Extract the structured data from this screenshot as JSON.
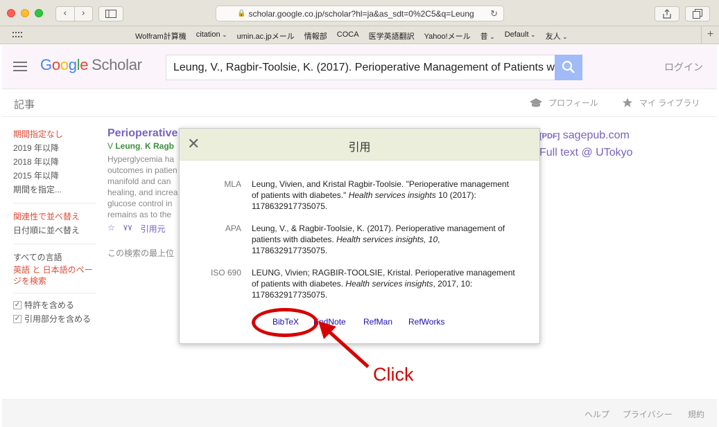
{
  "browser": {
    "url": "scholar.google.co.jp/scholar?hl=ja&as_sdt=0%2C5&q=Leung",
    "bookmarks": [
      "Wolfram計算機",
      "citation",
      "umin.ac.jpメール",
      "情報部",
      "COCA",
      "医学英語翻訳",
      "Yahoo!メール",
      "昔",
      "Default",
      "友人"
    ]
  },
  "header": {
    "logo_google": [
      "G",
      "o",
      "o",
      "g",
      "l",
      "e"
    ],
    "logo_scholar": "Scholar",
    "search_value": "Leung, V., Ragbir-Toolsie, K. (2017). Perioperative Management of Patients with Diabetes",
    "login": "ログイン"
  },
  "subbar": {
    "articles": "記事",
    "profile": "プロフィール",
    "library": "マイ ライブラリ"
  },
  "sidebar": {
    "date_filters": [
      "期間指定なし",
      "2019 年以降",
      "2018 年以降",
      "2015 年以降",
      "期間を指定..."
    ],
    "sort": [
      "関連性で並べ替え",
      "日付順に並べ替え"
    ],
    "lang": [
      "すべての言語",
      "英語 と 日本語のページを検索"
    ],
    "checks": [
      "特許を含める",
      "引用部分を含める"
    ]
  },
  "result": {
    "title": "Perioperative",
    "authors_prefix": "V ",
    "author1": "Leung",
    "author2": "K Ragb",
    "snippet": [
      "Hyperglycemia ha",
      "outcomes in patien",
      "manifold and can",
      "healing, and increa",
      "glucose control in",
      "remains as to the"
    ],
    "link_cited": "引用元",
    "footer_note": "この検索の最上位",
    "side_pdf": "[PDF]",
    "side_link1": "sagepub.com",
    "side_link2": "Full text @ UTokyo"
  },
  "modal": {
    "title": "引用",
    "mla_label": "MLA",
    "mla_text": "Leung, Vivien, and Kristal Ragbir-Toolsie. \"Perioperative management of patients with diabetes.\" ",
    "mla_journal": "Health services insights",
    "mla_tail": " 10 (2017): 1178632917735075.",
    "apa_label": "APA",
    "apa_text": "Leung, V., & Ragbir-Toolsie, K. (2017). Perioperative management of patients with diabetes. ",
    "apa_journal": "Health services insights, 10",
    "apa_tail": ", 1178632917735075.",
    "iso_label": "ISO 690",
    "iso_text": "LEUNG, Vivien; RAGBIR-TOOLSIE, Kristal. Perioperative management of patients with diabetes. ",
    "iso_journal": "Health services insights",
    "iso_tail": ", 2017, 10: 1178632917735075.",
    "exports": [
      "BibTeX",
      "EndNote",
      "RefMan",
      "RefWorks"
    ]
  },
  "annotation": {
    "label": "Click",
    "color": "#d60000"
  },
  "footer": [
    "ヘルプ",
    "プライバシー",
    "規約"
  ]
}
